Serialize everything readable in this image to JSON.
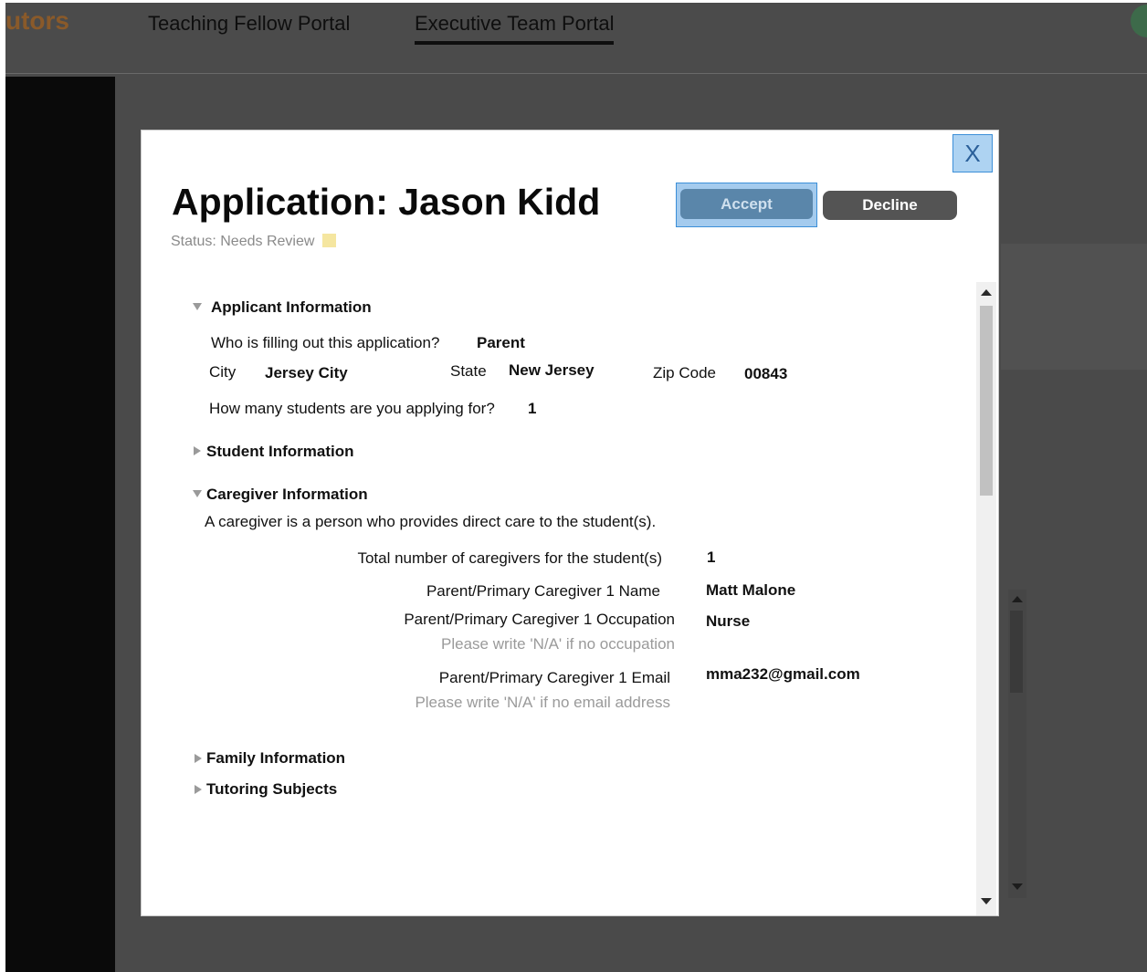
{
  "header": {
    "brand": "utors",
    "nav": [
      "Teaching Fellow Portal",
      "Executive Team Portal"
    ]
  },
  "modal": {
    "close_label": "X",
    "title": "Application: Jason Kidd",
    "status": "Status: Needs Review",
    "accept_label": "Accept",
    "decline_label": "Decline",
    "sections": {
      "applicant": {
        "label": "Applicant Information",
        "who_label": "Who is filling out this application?",
        "who_value": "Parent",
        "city_label": "City",
        "city_value": "Jersey City",
        "state_label": "State",
        "state_value": "New Jersey",
        "zip_label": "Zip Code",
        "zip_value": "00843",
        "students_label": "How many students are you applying for?",
        "students_value": "1"
      },
      "student": {
        "label": "Student Information"
      },
      "caregiver": {
        "label": "Caregiver Information",
        "description": "A caregiver is a person who provides direct care to the student(s).",
        "total_label": "Total number of caregivers for the student(s)",
        "total_value": "1",
        "name_label": "Parent/Primary Caregiver 1 Name",
        "name_value": "Matt Malone",
        "occupation_label": "Parent/Primary Caregiver 1 Occupation",
        "occupation_hint": "Please write 'N/A' if no occupation",
        "occupation_value": "Nurse",
        "email_label": "Parent/Primary Caregiver 1 Email",
        "email_hint": "Please write 'N/A' if no email address",
        "email_value": "mma232@gmail.com"
      },
      "family": {
        "label": "Family Information"
      },
      "tutoring": {
        "label": "Tutoring Subjects"
      }
    }
  },
  "colors": {
    "overlay": "#4a4a4a",
    "accept": "#5a86aa",
    "decline": "#545454",
    "status_needs_review": "#f5e6a0",
    "close_button": "#aed3f2"
  }
}
